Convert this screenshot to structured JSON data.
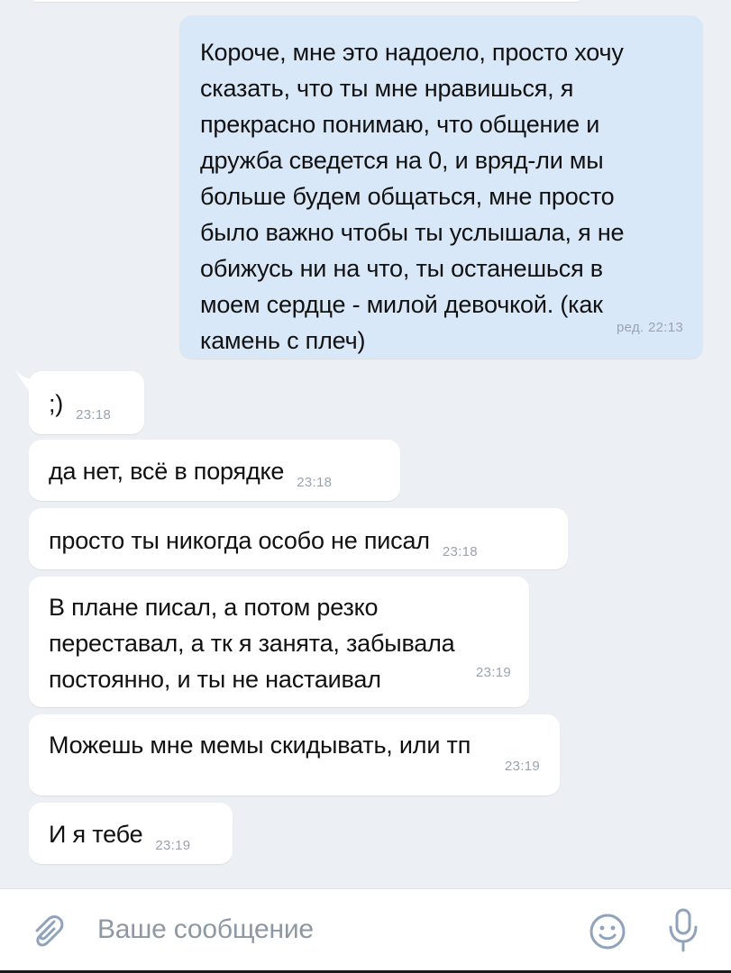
{
  "messages": [
    {
      "direction": "out",
      "text": "Короче, мне это надоело, просто хочу\nсказать, что ты мне нравишься, я\nпрекрасно понимаю, что общение и\nдружба сведется на 0,  и вряд-ли мы\nбольше будем общаться, мне просто\nбыло важно чтобы ты услышала, я не\nобижусь ни на что, ты останешься в\nмоем сердце - милой девочкой. (как\nкамень с плеч)",
      "time": "ред. 22:13"
    },
    {
      "direction": "in",
      "text": ";)",
      "time": "23:18"
    },
    {
      "direction": "in",
      "text": "да нет, всё в порядке",
      "time": "23:18"
    },
    {
      "direction": "in",
      "text": "просто ты никогда особо не писал",
      "time": "23:18"
    },
    {
      "direction": "in",
      "text": "В плане писал, а потом резко\nпереставал, а тк я занята, забывала\nпостоянно, и ты не настаивал",
      "time": "23:19"
    },
    {
      "direction": "in",
      "text": "Можешь мне мемы скидывать, или тп",
      "time": "23:19"
    },
    {
      "direction": "in",
      "text": "И я тебе",
      "time": "23:19"
    }
  ],
  "input": {
    "placeholder": "Ваше сообщение",
    "attach_icon": "paperclip-icon",
    "emoji_icon": "emoji-smile-icon",
    "mic_icon": "microphone-icon"
  },
  "colors": {
    "background": "#eceff3",
    "outgoing_bubble": "#d9e8f8",
    "incoming_bubble": "#ffffff",
    "timestamp": "#9aa3ad",
    "icon": "#8fa3bd"
  }
}
